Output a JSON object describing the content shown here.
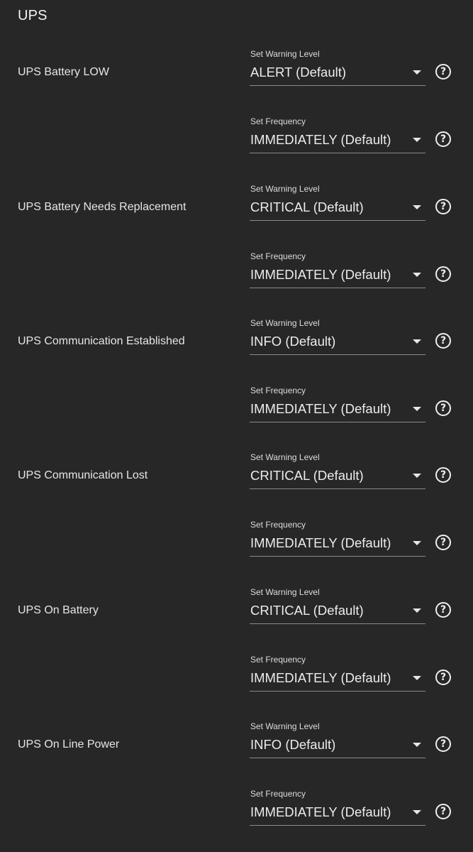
{
  "section": {
    "title": "UPS"
  },
  "help_glyph": "?",
  "groups": [
    {
      "label": "UPS Battery LOW",
      "warning": {
        "caption": "Set Warning Level",
        "value": "ALERT (Default)"
      },
      "frequency": {
        "caption": "Set Frequency",
        "value": "IMMEDIATELY (Default)"
      }
    },
    {
      "label": "UPS Battery Needs Replacement",
      "warning": {
        "caption": "Set Warning Level",
        "value": "CRITICAL (Default)"
      },
      "frequency": {
        "caption": "Set Frequency",
        "value": "IMMEDIATELY (Default)"
      }
    },
    {
      "label": "UPS Communication Established",
      "warning": {
        "caption": "Set Warning Level",
        "value": "INFO (Default)"
      },
      "frequency": {
        "caption": "Set Frequency",
        "value": "IMMEDIATELY (Default)"
      }
    },
    {
      "label": "UPS Communication Lost",
      "warning": {
        "caption": "Set Warning Level",
        "value": "CRITICAL (Default)"
      },
      "frequency": {
        "caption": "Set Frequency",
        "value": "IMMEDIATELY (Default)"
      }
    },
    {
      "label": "UPS On Battery",
      "warning": {
        "caption": "Set Warning Level",
        "value": "CRITICAL (Default)"
      },
      "frequency": {
        "caption": "Set Frequency",
        "value": "IMMEDIATELY (Default)"
      }
    },
    {
      "label": "UPS On Line Power",
      "warning": {
        "caption": "Set Warning Level",
        "value": "INFO (Default)"
      },
      "frequency": {
        "caption": "Set Frequency",
        "value": "IMMEDIATELY (Default)"
      }
    }
  ]
}
